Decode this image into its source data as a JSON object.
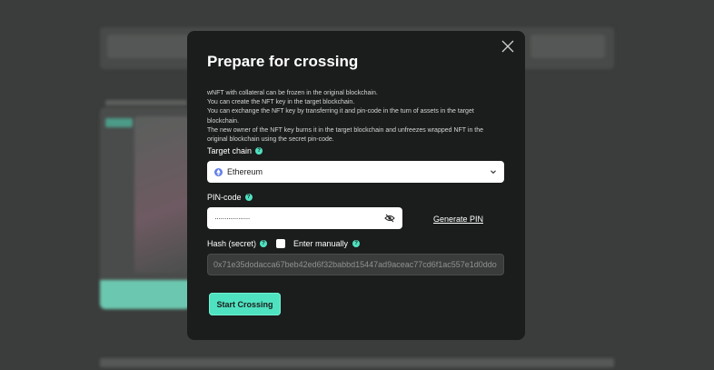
{
  "modal": {
    "title": "Prepare for crossing",
    "description": [
      "wNFT with collateral can be frozen in the original blockchain.",
      "You can create the NFT key in the target blockchain.",
      "You can exchange the NFT key by transferring it and pin-code in the turn of assets in the target blockchain.",
      "The new owner of the NFT key burns it in the target blockchain and unfreezes wrapped NFT in the original blockchain using the secret pin-code."
    ],
    "target_chain": {
      "label": "Target chain",
      "value": "Ethereum",
      "icon": "ethereum-icon"
    },
    "pin": {
      "label": "PIN-code",
      "value": "··················",
      "generate_label": "Generate PIN"
    },
    "hash": {
      "label": "Hash (secret)",
      "manual_label": "Enter manually",
      "value": "0x71e35dodacca67beb42ed6f32babbd15447ad9aceac77cd6f1ac557e1d0ddo"
    },
    "start_label": "Start Crossing"
  },
  "colors": {
    "accent": "#4fe2c0",
    "modal_bg": "#1b1c1c",
    "overlay": "#3b3d3c"
  }
}
